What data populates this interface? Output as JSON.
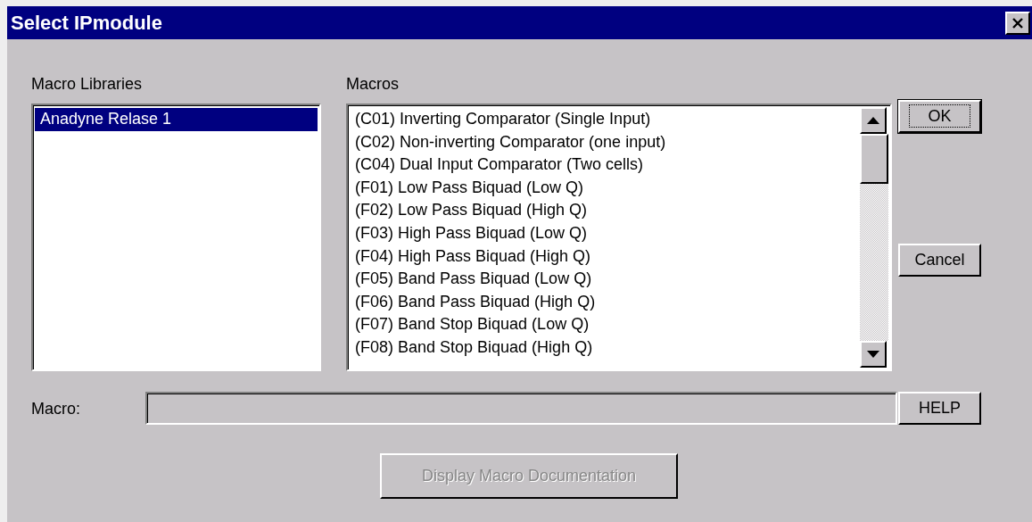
{
  "window": {
    "title": "Select IPmodule"
  },
  "libraries": {
    "label": "Macro Libraries",
    "items": [
      {
        "label": "Anadyne Relase 1",
        "selected": true
      }
    ]
  },
  "macros": {
    "label": "Macros",
    "items": [
      {
        "label": "(C01) Inverting Comparator (Single Input)",
        "selected": false
      },
      {
        "label": "(C02) Non-inverting Comparator (one input)",
        "selected": false
      },
      {
        "label": "(C04) Dual Input Comparator (Two cells)",
        "selected": false
      },
      {
        "label": "(F01) Low Pass Biquad (Low Q)",
        "selected": false
      },
      {
        "label": "(F02) Low Pass Biquad (High Q)",
        "selected": false
      },
      {
        "label": "(F03) High Pass Biquad (Low Q)",
        "selected": false
      },
      {
        "label": "(F04) High Pass Biquad (High Q)",
        "selected": false
      },
      {
        "label": "(F05) Band Pass Biquad (Low Q)",
        "selected": false
      },
      {
        "label": "(F06) Band Pass Biquad (High Q)",
        "selected": false
      },
      {
        "label": "(F07) Band Stop Biquad (Low Q)",
        "selected": false
      },
      {
        "label": "(F08) Band Stop Biquad (High Q)",
        "selected": false
      }
    ]
  },
  "macro_field": {
    "label": "Macro:"
  },
  "buttons": {
    "ok": {
      "label": "OK",
      "default": true
    },
    "cancel": {
      "label": "Cancel"
    },
    "help": {
      "label": "HELP"
    },
    "documentation": {
      "label": "Display Macro Documentation",
      "disabled": true
    }
  }
}
